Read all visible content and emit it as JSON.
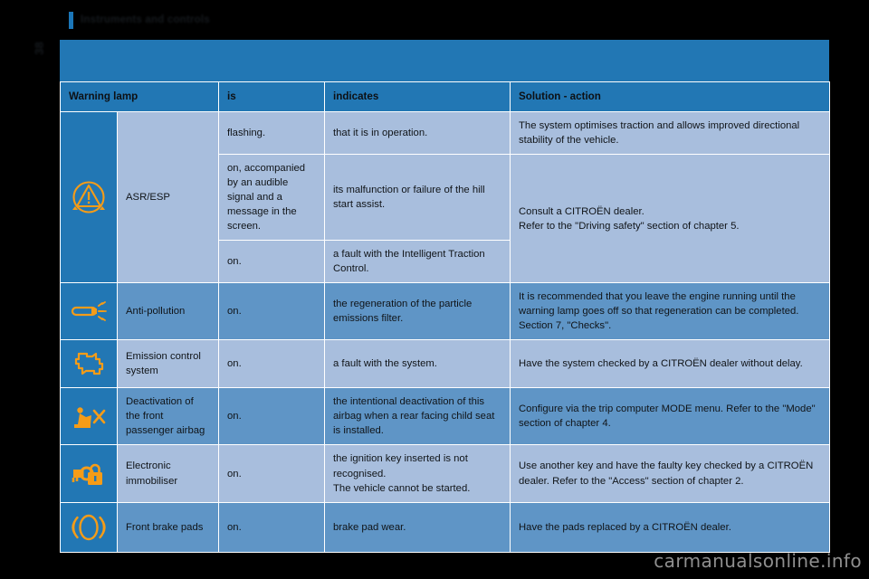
{
  "running_head": {
    "title": "Instruments and controls"
  },
  "folio": {
    "page_number": "38"
  },
  "watermark": {
    "text": "carmanualsonline.info"
  },
  "colors": {
    "header_blue": "#2277b4",
    "row_light": "#a8bedd",
    "row_medium": "#5f95c6",
    "icon_orange": "#f59c18",
    "grid_white": "#ffffff"
  },
  "table": {
    "headers": {
      "warning_lamp": "Warning lamp",
      "is": "is",
      "indicates": "indicates",
      "solution": "Solution - action"
    },
    "rows": [
      {
        "icon": "esp-skid-warning-icon",
        "name": "ASR/ESP",
        "subrows": [
          {
            "is": "flashing.",
            "indicates": "that it is in operation.",
            "solution": "The system optimises traction and allows improved directional stability of the vehicle."
          },
          {
            "is": "on, accompanied by an audible signal and a message in the screen.",
            "indicates": "its malfunction or failure of the hill start assist.",
            "solution_line1": "Consult a CITROËN dealer.",
            "solution_line2": "Refer to the \"Driving safety\" section of chapter 5."
          },
          {
            "is": "on.",
            "indicates": "a fault with the Intelligent Traction Control."
          }
        ]
      },
      {
        "icon": "exhaust-anti-pollution-icon",
        "name": "Anti-pollution",
        "is": "on.",
        "indicates": "the regeneration of the particle emissions filter.",
        "solution": "It is recommended that you leave the engine running until the warning lamp goes off so that regeneration can be completed. Section 7, \"Checks\"."
      },
      {
        "icon": "check-engine-icon",
        "name": "Emission control system",
        "is": "on.",
        "indicates": "a fault with the system.",
        "solution": "Have the system checked by a CITROËN dealer without delay."
      },
      {
        "icon": "passenger-airbag-off-icon",
        "name": "Deactivation of the front passenger airbag",
        "is": "on.",
        "indicates": "the intentional deactivation of this airbag when a rear facing child seat is installed.",
        "solution": "Configure via the trip computer MODE menu. Refer to the \"Mode\" section of chapter 4."
      },
      {
        "icon": "electronic-immobiliser-icon",
        "name": "Electronic immobiliser",
        "is": "on.",
        "indicates_line1": "the ignition key inserted is not recognised.",
        "indicates_line2": "The vehicle cannot be started.",
        "solution": "Use another key and have the faulty key checked by a CITROËN dealer. Refer to the \"Access\" section of chapter 2."
      },
      {
        "icon": "front-brake-pads-icon",
        "name": "Front brake pads",
        "is": "on.",
        "indicates": "brake pad wear.",
        "solution": "Have the pads replaced by a CITROËN dealer."
      }
    ]
  }
}
